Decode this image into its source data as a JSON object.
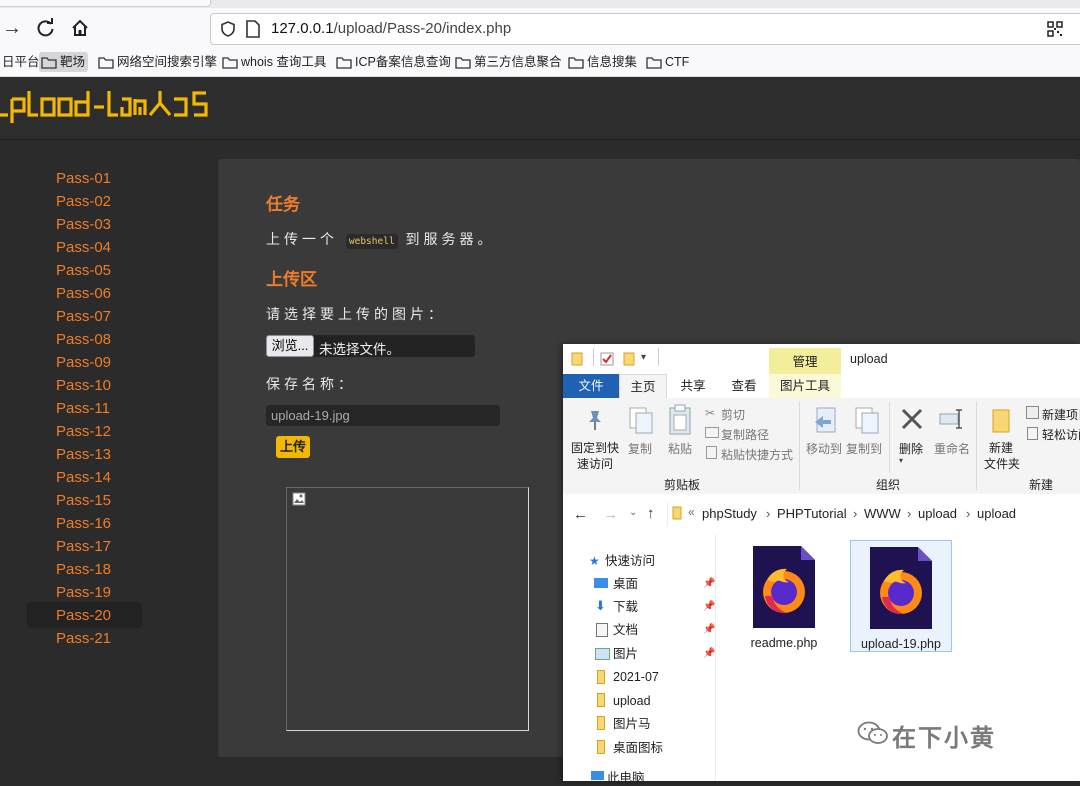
{
  "browser": {
    "url_host": "127.0.0.1",
    "url_path": "/upload/Pass-20/index.php",
    "bookmarks": [
      "日平台",
      "靶场",
      "网络空间搜索引擎",
      "whois 查询工具",
      "ICP备案信息查询",
      "第三方信息聚合",
      "信息搜集",
      "CTF"
    ]
  },
  "site": {
    "logo": "UpLoad-labS"
  },
  "sidebar": {
    "items": [
      "Pass-01",
      "Pass-02",
      "Pass-03",
      "Pass-04",
      "Pass-05",
      "Pass-06",
      "Pass-07",
      "Pass-08",
      "Pass-09",
      "Pass-10",
      "Pass-11",
      "Pass-12",
      "Pass-13",
      "Pass-14",
      "Pass-15",
      "Pass-16",
      "Pass-17",
      "Pass-18",
      "Pass-19",
      "Pass-20",
      "Pass-21"
    ],
    "active": "Pass-20"
  },
  "main": {
    "task_heading": "任务",
    "task_prefix": "上传一个",
    "task_code": "webshell",
    "task_suffix": "到服务器。",
    "upload_heading": "上传区",
    "choose_label": "请选择要上传的图片：",
    "browse_label": "浏览...",
    "file_status": "未选择文件。",
    "save_label": "保存名称：",
    "save_value": "upload-19.jpg",
    "upload_button": "上传"
  },
  "explorer": {
    "manage_tab": "管理",
    "title": "upload",
    "tabs": {
      "file": "文件",
      "home": "主页",
      "share": "共享",
      "view": "查看",
      "picture_tools": "图片工具"
    },
    "ribbon": {
      "pin": "固定到快速访问",
      "pin_line1": "固定到快",
      "pin_line2": "速访问",
      "copy": "复制",
      "paste": "粘贴",
      "cut": "剪切",
      "copy_path": "复制路径",
      "paste_shortcut": "粘贴快捷方式",
      "clipboard_group": "剪贴板",
      "move_to": "移动到",
      "copy_to": "复制到",
      "delete": "删除",
      "rename": "重命名",
      "organize_group": "组织",
      "new_folder_line1": "新建",
      "new_folder_line2": "文件夹",
      "new_item": "新建项目",
      "easy_access": "轻松访问",
      "new_group": "新建"
    },
    "breadcrumb": [
      "phpStudy",
      "PHPTutorial",
      "WWW",
      "upload",
      "upload"
    ],
    "nav": {
      "quick_access": "快速访问",
      "items": [
        "桌面",
        "下载",
        "文档",
        "图片",
        "2021-07",
        "upload",
        "图片马",
        "桌面图标"
      ],
      "this_pc": "此电脑"
    },
    "files": [
      "readme.php",
      "upload-19.php"
    ]
  },
  "watermark": "在下小黄",
  "colors": {
    "accent": "#f07c2a",
    "page_bg": "#2b2b2b",
    "card_bg": "#3a3a3a",
    "upload_button": "#f5b800",
    "explorer_file_tab": "#1f62b4",
    "manage_tab": "#f3ee9b"
  }
}
